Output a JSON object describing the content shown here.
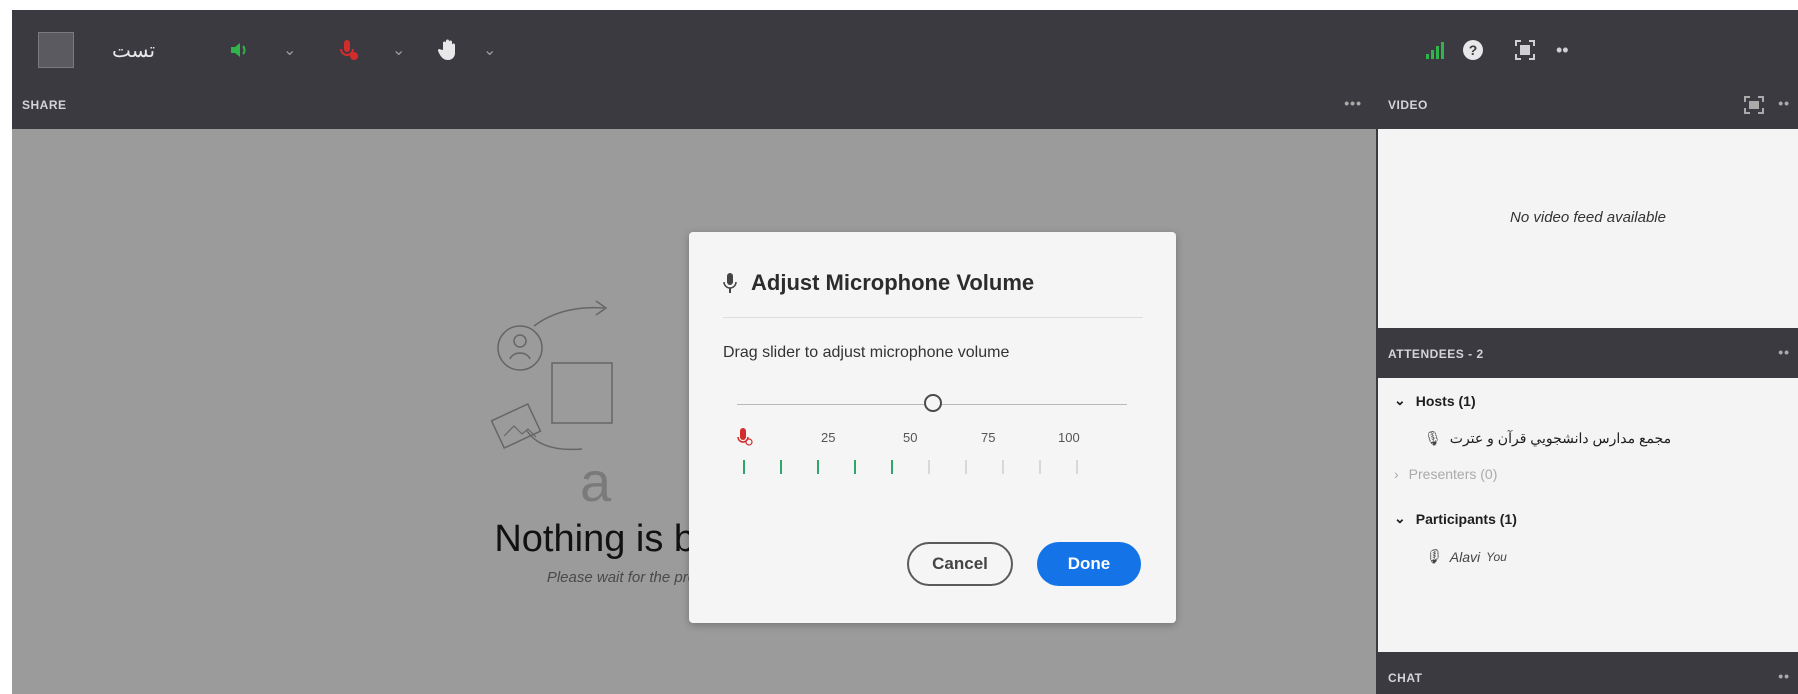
{
  "topbar": {
    "meeting_title": "تست",
    "status_color": "#2fb54a",
    "icons": [
      "layout-icon",
      "speaker-icon",
      "microphone-icon",
      "raise-hand-icon",
      "signal-icon",
      "help-icon",
      "fullscreen-icon",
      "more-icon"
    ]
  },
  "share_pod": {
    "title": "SHARE",
    "menu": "•••",
    "empty_title": "Nothing is being shared",
    "empty_subtitle": "Please wait for the presenter to start sharing"
  },
  "video_pod": {
    "title": "VIDEO",
    "menu": "••",
    "message": "No video feed available"
  },
  "attendees_pod": {
    "title": "ATTENDEES - 2",
    "menu": "••",
    "groups": [
      {
        "label": "Hosts (1)",
        "expanded": true
      },
      {
        "label": "Presenters (0)",
        "expanded": false
      },
      {
        "label": "Participants (1)",
        "expanded": true
      }
    ],
    "host_name": "مجمع مدارس دانشجويي قرآن و عترت",
    "participant_name": "Alavi",
    "participant_you": "You"
  },
  "chat_pod": {
    "title": "CHAT",
    "menu": "••"
  },
  "dialog": {
    "title": "Adjust Microphone Volume",
    "instruction": "Drag slider to adjust microphone volume",
    "slider_value": 50,
    "scale_labels": [
      "25",
      "50",
      "75",
      "100"
    ],
    "meter_active_bars": 5,
    "meter_total_bars": 10,
    "cancel_label": "Cancel",
    "done_label": "Done",
    "accent_color": "#1473e6"
  }
}
